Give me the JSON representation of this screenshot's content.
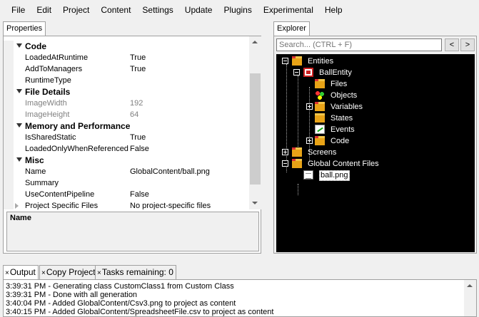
{
  "menu": [
    "File",
    "Edit",
    "Project",
    "Content",
    "Settings",
    "Update",
    "Plugins",
    "Experimental",
    "Help"
  ],
  "properties": {
    "tab_label": "Properties",
    "rows": [
      {
        "kind": "category",
        "name": "Code"
      },
      {
        "kind": "prop",
        "name": "LoadedAtRuntime",
        "value": "True"
      },
      {
        "kind": "prop",
        "name": "AddToManagers",
        "value": "True"
      },
      {
        "kind": "prop",
        "name": "RuntimeType",
        "value": ""
      },
      {
        "kind": "category",
        "name": "File Details"
      },
      {
        "kind": "readonly",
        "name": "ImageWidth",
        "value": "192"
      },
      {
        "kind": "readonly",
        "name": "ImageHeight",
        "value": "64"
      },
      {
        "kind": "category",
        "name": "Memory and Performance"
      },
      {
        "kind": "prop",
        "name": "IsSharedStatic",
        "value": "True"
      },
      {
        "kind": "prop",
        "name": "LoadedOnlyWhenReferenced",
        "value": "False"
      },
      {
        "kind": "category",
        "name": "Misc"
      },
      {
        "kind": "prop",
        "name": "Name",
        "value": "GlobalContent/ball.png"
      },
      {
        "kind": "prop",
        "name": "Summary",
        "value": ""
      },
      {
        "kind": "prop",
        "name": "UseContentPipeline",
        "value": "False"
      },
      {
        "kind": "expandable",
        "name": "Project Specific Files",
        "value": "No project-specific files"
      }
    ],
    "description_title": "Name"
  },
  "explorer": {
    "tab_label": "Explorer",
    "search_placeholder": "Search... (CTRL + F)",
    "back_label": "<",
    "forward_label": ">",
    "tree": [
      {
        "label": "Entities",
        "icon": "folder-icon",
        "expander": "minus"
      },
      {
        "label": "BallEntity",
        "icon": "entity-icon",
        "expander": "minus"
      },
      {
        "label": "Files",
        "icon": "folder-icon",
        "expander": ""
      },
      {
        "label": "Objects",
        "icon": "objects-icon",
        "expander": ""
      },
      {
        "label": "Variables",
        "icon": "folder-icon",
        "expander": "plus"
      },
      {
        "label": "States",
        "icon": "folder-icon",
        "expander": ""
      },
      {
        "label": "Events",
        "icon": "events-icon",
        "expander": ""
      },
      {
        "label": "Code",
        "icon": "folder-icon",
        "expander": "plus"
      },
      {
        "label": "Screens",
        "icon": "folder-icon",
        "expander": "plus"
      },
      {
        "label": "Global Content Files",
        "icon": "folder-icon",
        "expander": "minus"
      },
      {
        "label": "ball.png",
        "icon": "file-icon",
        "expander": "",
        "selected": true
      }
    ]
  },
  "bottom_tabs": [
    {
      "close": "×",
      "label": "Output"
    },
    {
      "close": "×",
      "label": "Copy Project"
    },
    {
      "close": "×",
      "label": "Tasks remaining: 0"
    }
  ],
  "log": [
    "3:39:31 PM - Generating class CustomClass1 from Custom Class",
    "3:39:31 PM - Done with all generation",
    "3:40:04 PM - Added GlobalContent/Csv3.png to project as content",
    "3:40:15 PM - Added GlobalContent/SpreadsheetFile.csv to project as content"
  ]
}
